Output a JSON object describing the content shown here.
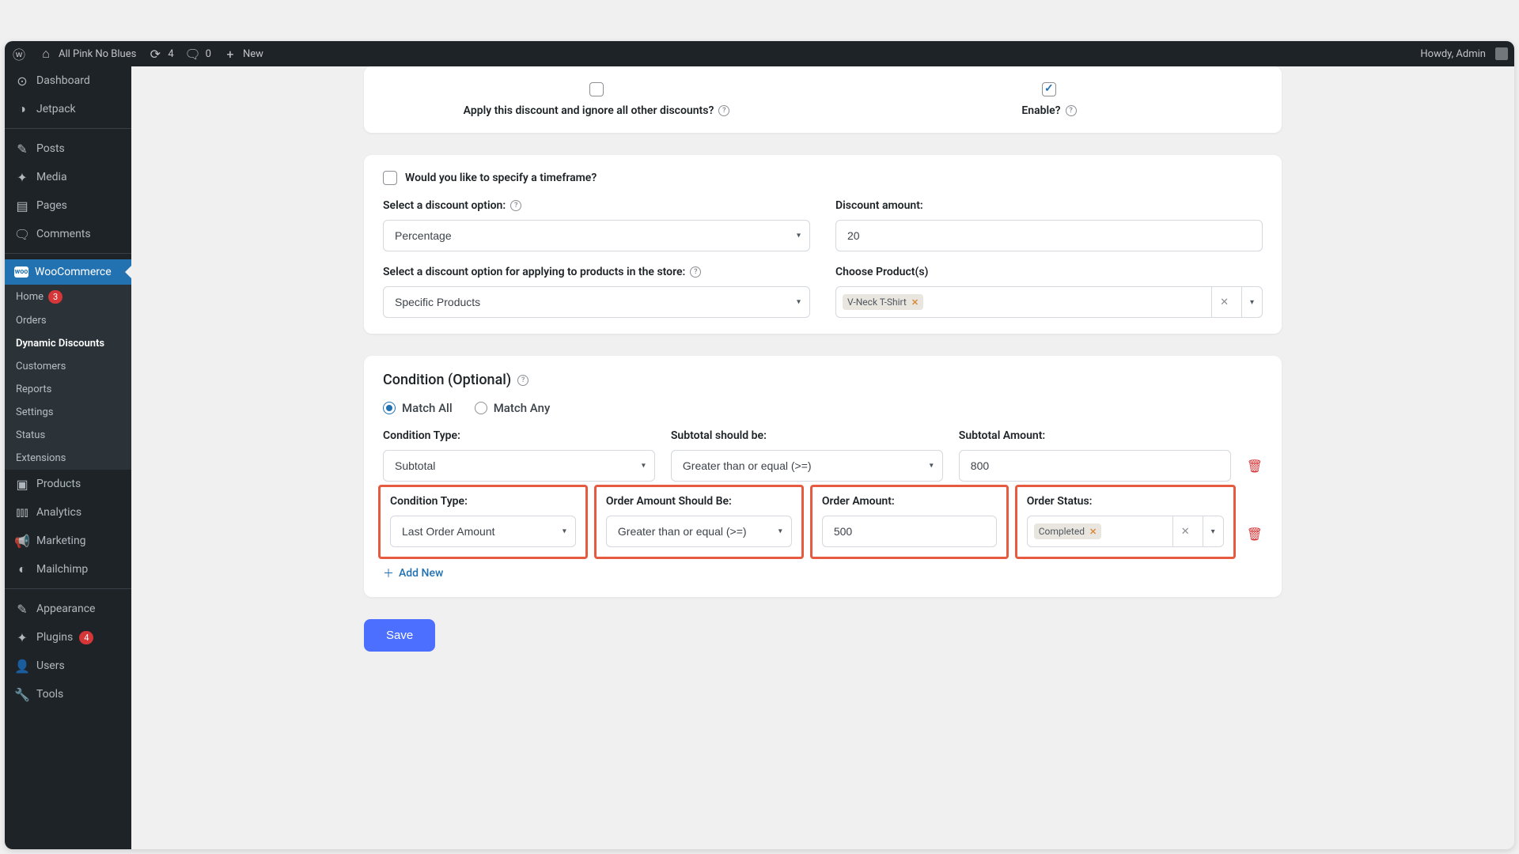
{
  "adminbar": {
    "site": "All Pink No Blues",
    "updates": "4",
    "comments": "0",
    "new": "New",
    "howdy": "Howdy, Admin"
  },
  "sidebar": {
    "items": [
      {
        "label": "Dashboard"
      },
      {
        "label": "Jetpack"
      },
      {
        "label": "Posts"
      },
      {
        "label": "Media"
      },
      {
        "label": "Pages"
      },
      {
        "label": "Comments"
      },
      {
        "label": "WooCommerce"
      },
      {
        "label": "Products"
      },
      {
        "label": "Analytics"
      },
      {
        "label": "Marketing"
      },
      {
        "label": "Mailchimp"
      },
      {
        "label": "Appearance"
      },
      {
        "label": "Plugins"
      },
      {
        "label": "Users"
      },
      {
        "label": "Tools"
      }
    ],
    "plugin_count": "4",
    "woo_sub": {
      "home": "Home",
      "home_count": "3",
      "orders": "Orders",
      "dynamic": "Dynamic Discounts",
      "customers": "Customers",
      "reports": "Reports",
      "settings": "Settings",
      "status": "Status",
      "extensions": "Extensions"
    }
  },
  "panel1": {
    "apply_label": "Apply this discount and ignore all other discounts?",
    "enable_label": "Enable?"
  },
  "panel2": {
    "timeframe_label": "Would you like to specify a timeframe?",
    "discount_option_label": "Select a discount option:",
    "discount_option_value": "Percentage",
    "discount_amount_label": "Discount amount:",
    "discount_amount_value": "20",
    "apply_products_label": "Select a discount option for applying to products in the store:",
    "apply_products_value": "Specific Products",
    "choose_products_label": "Choose Product(s)",
    "product_tag": "V-Neck T-Shirt"
  },
  "panel3": {
    "title": "Condition (Optional)",
    "match_all": "Match All",
    "match_any": "Match Any",
    "row1": {
      "type_label": "Condition Type:",
      "type_value": "Subtotal",
      "should_label": "Subtotal should be:",
      "should_value": "Greater than or equal (>=)",
      "amount_label": "Subtotal Amount:",
      "amount_value": "800"
    },
    "row2": {
      "type_label": "Condition Type:",
      "type_value": "Last Order Amount",
      "should_label": "Order Amount Should Be:",
      "should_value": "Greater than or equal (>=)",
      "amount_label": "Order Amount:",
      "amount_value": "500",
      "status_label": "Order Status:",
      "status_tag": "Completed"
    },
    "add_new": "Add New"
  },
  "save": "Save"
}
